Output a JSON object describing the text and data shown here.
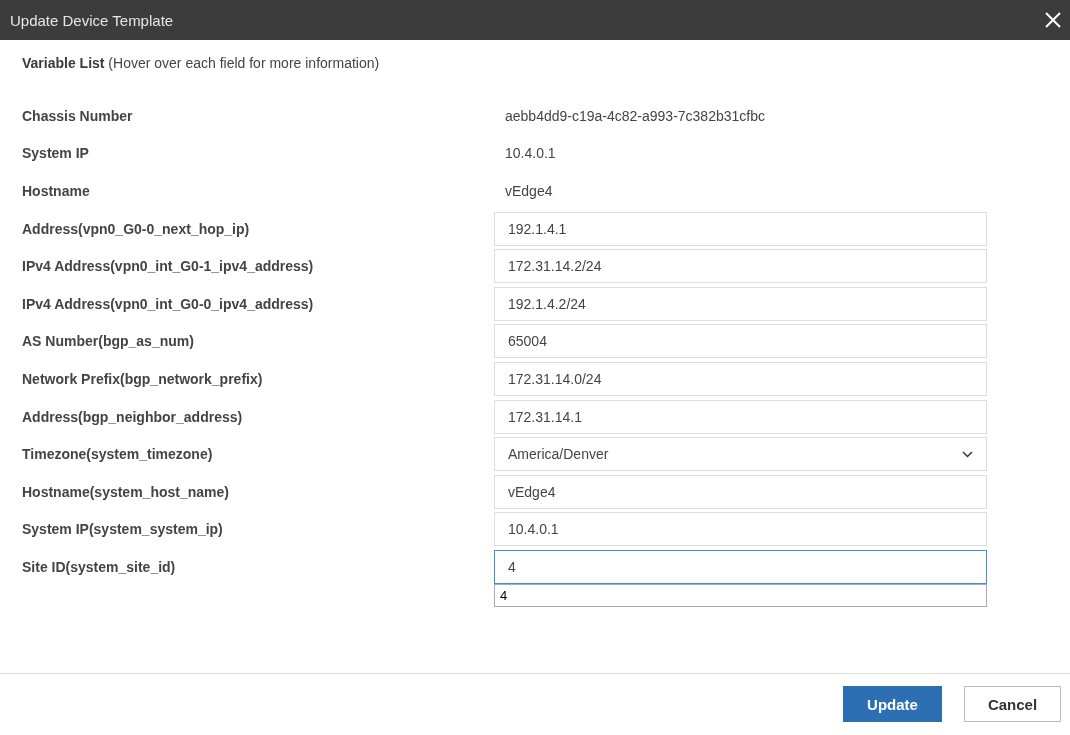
{
  "window": {
    "title": "Update Device Template"
  },
  "header": {
    "title": "Variable List",
    "hint": "(Hover over each field for more information)"
  },
  "rows": [
    {
      "kind": "static",
      "label": "Chassis Number",
      "value": "aebb4dd9-c19a-4c82-a993-7c382b31cfbc"
    },
    {
      "kind": "static",
      "label": "System IP",
      "value": "10.4.0.1"
    },
    {
      "kind": "static",
      "label": "Hostname",
      "value": "vEdge4"
    },
    {
      "kind": "input",
      "label": "Address(vpn0_G0-0_next_hop_ip)",
      "value": "192.1.4.1",
      "focused": false
    },
    {
      "kind": "input",
      "label": "IPv4 Address(vpn0_int_G0-1_ipv4_address)",
      "value": "172.31.14.2/24",
      "focused": false
    },
    {
      "kind": "input",
      "label": "IPv4 Address(vpn0_int_G0-0_ipv4_address)",
      "value": "192.1.4.2/24",
      "focused": false
    },
    {
      "kind": "input",
      "label": "AS Number(bgp_as_num)",
      "value": "65004",
      "focused": false
    },
    {
      "kind": "input",
      "label": "Network Prefix(bgp_network_prefix)",
      "value": "172.31.14.0/24",
      "focused": false
    },
    {
      "kind": "input",
      "label": "Address(bgp_neighbor_address)",
      "value": "172.31.14.1",
      "focused": false
    },
    {
      "kind": "select",
      "label": "Timezone(system_timezone)",
      "value": "America/Denver",
      "focused": false
    },
    {
      "kind": "input",
      "label": "Hostname(system_host_name)",
      "value": "vEdge4",
      "focused": false
    },
    {
      "kind": "input",
      "label": "System IP(system_system_ip)",
      "value": "10.4.0.1",
      "focused": false
    },
    {
      "kind": "input",
      "label": "Site ID(system_site_id)",
      "value": "4",
      "focused": true,
      "suggestions": [
        "4"
      ]
    }
  ],
  "buttons": [
    {
      "label": "Update",
      "kind": "primary"
    },
    {
      "label": "Cancel",
      "kind": "secondary"
    }
  ]
}
